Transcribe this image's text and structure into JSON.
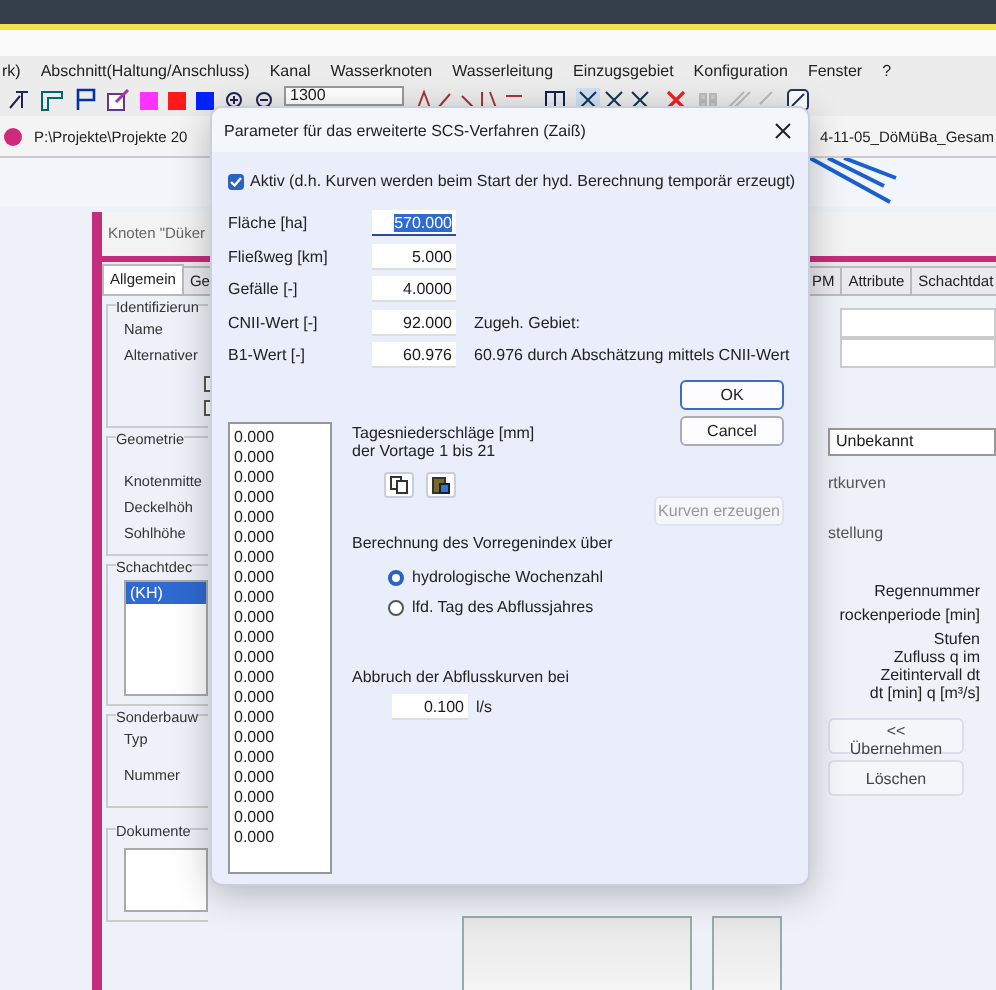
{
  "menu": [
    "rk)",
    "Abschnitt(Haltung/Anschluss)",
    "Kanal",
    "Wasserknoten",
    "Wasserleitung",
    "Einzugsgebiet",
    "Konfiguration",
    "Fenster",
    "?"
  ],
  "toolbar": {
    "zoom_value": "1300",
    "swatches": [
      {
        "color": "#ff33ff"
      },
      {
        "color": "#ff1a1a"
      },
      {
        "color": "#0022ff"
      }
    ]
  },
  "path_bar": {
    "left": "P:\\Projekte\\Projekte 20",
    "right": "4-11-05_DöMüBa_Gesam"
  },
  "node_window": {
    "title": "Knoten \"Düker",
    "tabs": [
      {
        "label": "Allgemein",
        "selected": true
      },
      {
        "label": "Ge",
        "selected": false
      },
      {
        "label": "PM",
        "selected": false
      },
      {
        "label": "Attribute",
        "selected": false
      },
      {
        "label": "Schachtdat",
        "selected": false
      }
    ],
    "identification": {
      "title": "Identifizierun",
      "labels": [
        "Name",
        "Alternativer"
      ],
      "checkboxes": [
        {
          "checked": false
        },
        {
          "checked": false
        }
      ]
    },
    "geometry": {
      "title": "Geometrie",
      "labels": [
        "Knotenmitte",
        "Deckelhöh",
        "Sohlhöhe"
      ]
    },
    "shaft": {
      "title": "Schachtdec",
      "items": [
        {
          "label": "(KH)",
          "selected": true
        }
      ]
    },
    "special": {
      "title": "Sonderbauw",
      "labels": [
        "Typ",
        "Nummer"
      ]
    },
    "documents": {
      "title": "Dokumente"
    },
    "right": {
      "type_value": "Unbekannt",
      "section_1": "rtkurven",
      "section_2": "stellung",
      "labels": [
        "Regennummer",
        "rockenperiode [min]",
        "Stufen",
        "Zufluss q im",
        "Zeitintervall dt",
        "dt [min]   q [m³/s]"
      ],
      "apply_button": "<< Übernehmen",
      "delete_button": "Löschen"
    }
  },
  "dialog": {
    "title": "Parameter für das erweiterte SCS-Verfahren (Zaiß)",
    "active": {
      "label": "Aktiv (d.h. Kurven werden beim Start der hyd. Berechnung temporär erzeugt)",
      "checked": true
    },
    "fields": [
      {
        "label": "Fläche [ha]",
        "value": "570.000",
        "selected": true
      },
      {
        "label": "Fließweg [km]",
        "value": "5.000",
        "selected": false
      },
      {
        "label": "Gefälle [-]",
        "value": "4.0000",
        "selected": false
      },
      {
        "label": "CNII-Wert [-]",
        "value": "92.000",
        "selected": false,
        "note": "Zugeh. Gebiet:"
      },
      {
        "label": "B1-Wert [-]",
        "value": "60.976",
        "selected": false,
        "note": "60.976 durch Abschätzung mittels CNII-Wert"
      }
    ],
    "ok": "OK",
    "cancel": "Cancel",
    "generate": {
      "label": "Kurven erzeugen",
      "disabled": true
    },
    "rainfall_values": [
      "0.000",
      "0.000",
      "0.000",
      "0.000",
      "0.000",
      "0.000",
      "0.000",
      "0.000",
      "0.000",
      "0.000",
      "0.000",
      "0.000",
      "0.000",
      "0.000",
      "0.000",
      "0.000",
      "0.000",
      "0.000",
      "0.000",
      "0.000",
      "0.000"
    ],
    "rainfall_label": [
      "Tagesniederschläge [mm]",
      "der Vortage 1 bis 21"
    ],
    "index_label": "Berechnung des Vorregenindex über",
    "index_options": [
      {
        "label": "hydrologische Wochenzahl",
        "selected": true
      },
      {
        "label": "lfd. Tag des Abflussjahres",
        "selected": false
      }
    ],
    "cutoff": {
      "label": "Abbruch der Abflusskurven bei",
      "value": "0.100",
      "unit": "l/s"
    }
  }
}
